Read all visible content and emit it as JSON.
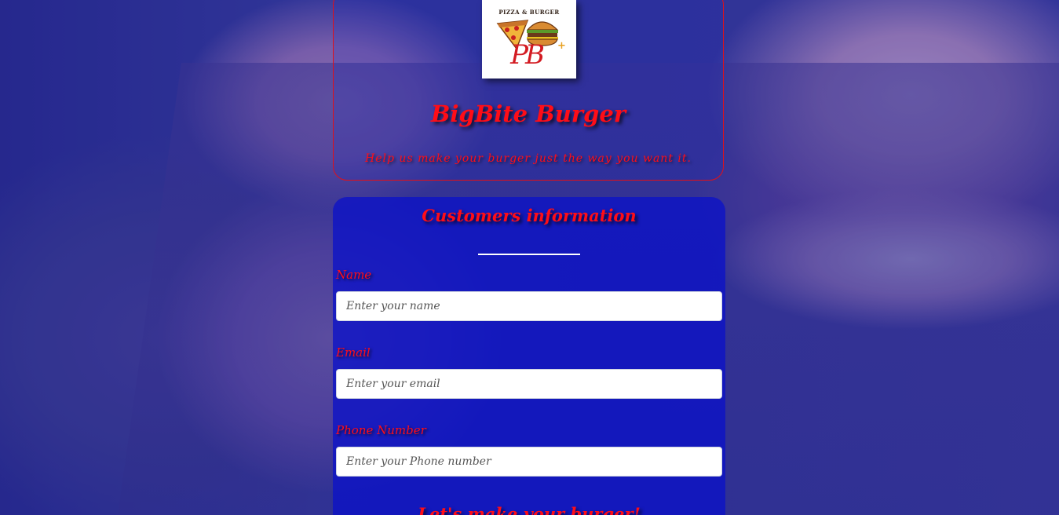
{
  "logo": {
    "top_text": "PIZZA & BURGER",
    "letters": "PB",
    "plus": "+"
  },
  "header": {
    "title": "BigBite Burger",
    "subtitle": "Help us make your burger just the way you want it."
  },
  "form": {
    "section_title": "Customers information",
    "fields": [
      {
        "label": "Name",
        "placeholder": "Enter your name"
      },
      {
        "label": "Email",
        "placeholder": "Enter your email"
      },
      {
        "label": "Phone Number",
        "placeholder": "Enter your Phone number"
      }
    ],
    "next_section_title": "Let's make your burger!"
  },
  "colors": {
    "accent_red": "#ff0d17",
    "card_blue": "#0c12c8",
    "logo_red": "#d31b22"
  }
}
